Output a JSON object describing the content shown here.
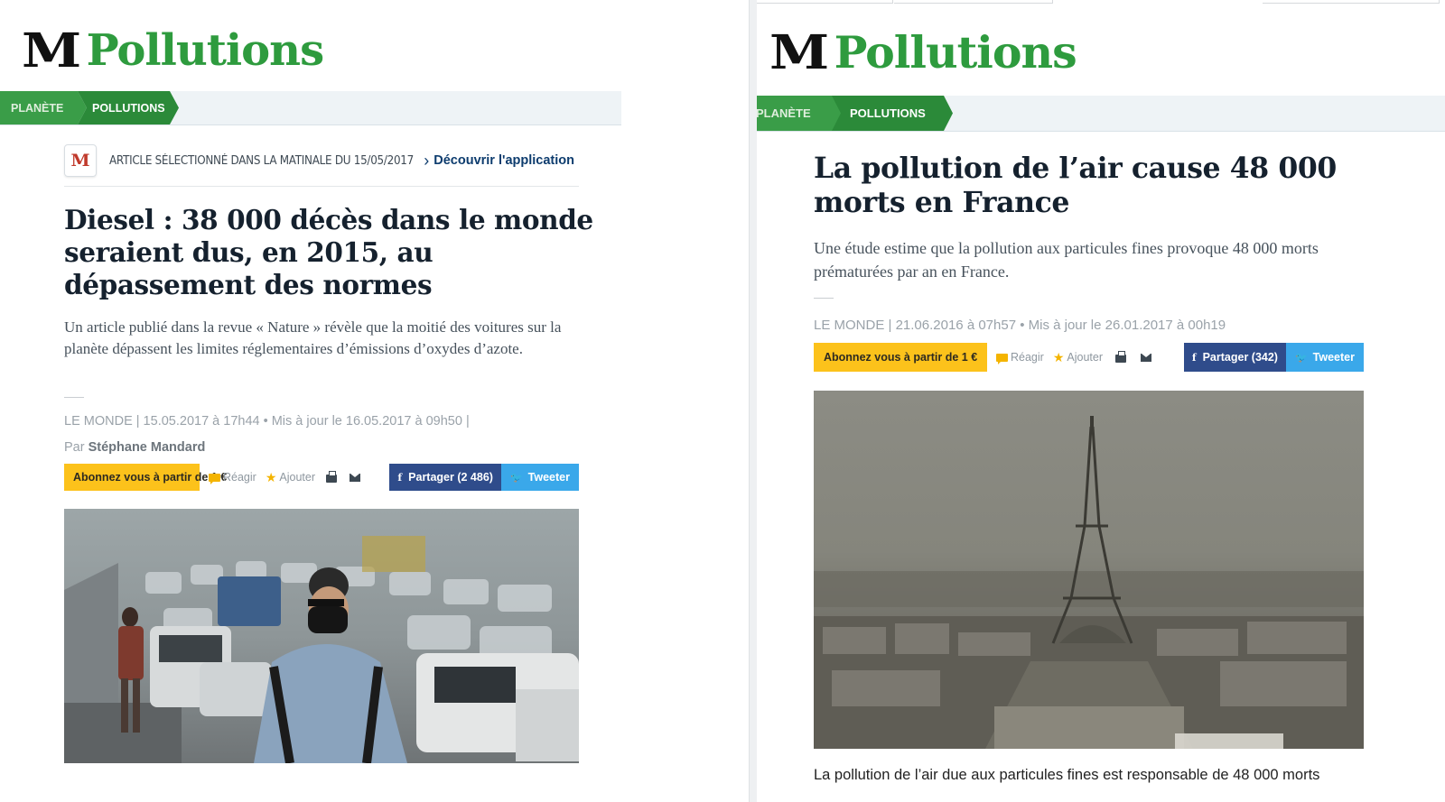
{
  "left": {
    "logo_mark": "M",
    "section_title": "Pollutions",
    "breadcrumb": [
      "PLANÈTE",
      "POLLUTIONS"
    ],
    "matinale_text": "ARTICLE SÉLECTIONNÉ DANS LA MATINALE DU 15/05/2017",
    "matinale_link": "Découvrir l'application",
    "headline": "Diesel : 38 000 décès dans le monde seraient dus, en 2015, au dépassement des normes",
    "dek": "Un article publié dans la revue « Nature » révèle que la moitié des voitures sur la planète dépassent les limites réglementaires d’émissions d’oxydes d’azote.",
    "meta": "LE MONDE | 15.05.2017 à 17h44 • Mis à jour le 16.05.2017 à 09h50 |",
    "byline_prefix": "Par",
    "author": "Stéphane Mandard",
    "actions": {
      "subscribe": "Abonnez vous à partir de 1 €",
      "react": "Réagir",
      "add": "Ajouter",
      "share": "Partager (2 486)",
      "tweet": "Tweeter"
    },
    "photo_icon": "traffic-pollution-photo"
  },
  "right": {
    "logo_mark": "M",
    "section_title": "Pollutions",
    "breadcrumb": [
      "PLANÈTE",
      "POLLUTIONS"
    ],
    "headline": "La pollution de l’air cause 48 000 morts en France",
    "dek": "Une étude estime que la pollution aux particules fines provoque 48 000 morts prématurées par an en France.",
    "meta": "LE MONDE | 21.06.2016 à 07h57 • Mis à jour le 26.01.2017 à 00h19",
    "actions": {
      "subscribe": "Abonnez vous à partir de 1 €",
      "react": "Réagir",
      "add": "Ajouter",
      "share": "Partager (342)",
      "tweet": "Tweeter"
    },
    "photo_icon": "eiffel-tower-smog-photo",
    "body_start": "La pollution de l’air due aux particules fines est responsable de 48 000 morts"
  },
  "colors": {
    "brand_green": "#2e9b3e",
    "subscribe_yellow": "#fcc21b",
    "facebook_blue": "#2f4c8b",
    "twitter_blue": "#3aa8ea"
  }
}
